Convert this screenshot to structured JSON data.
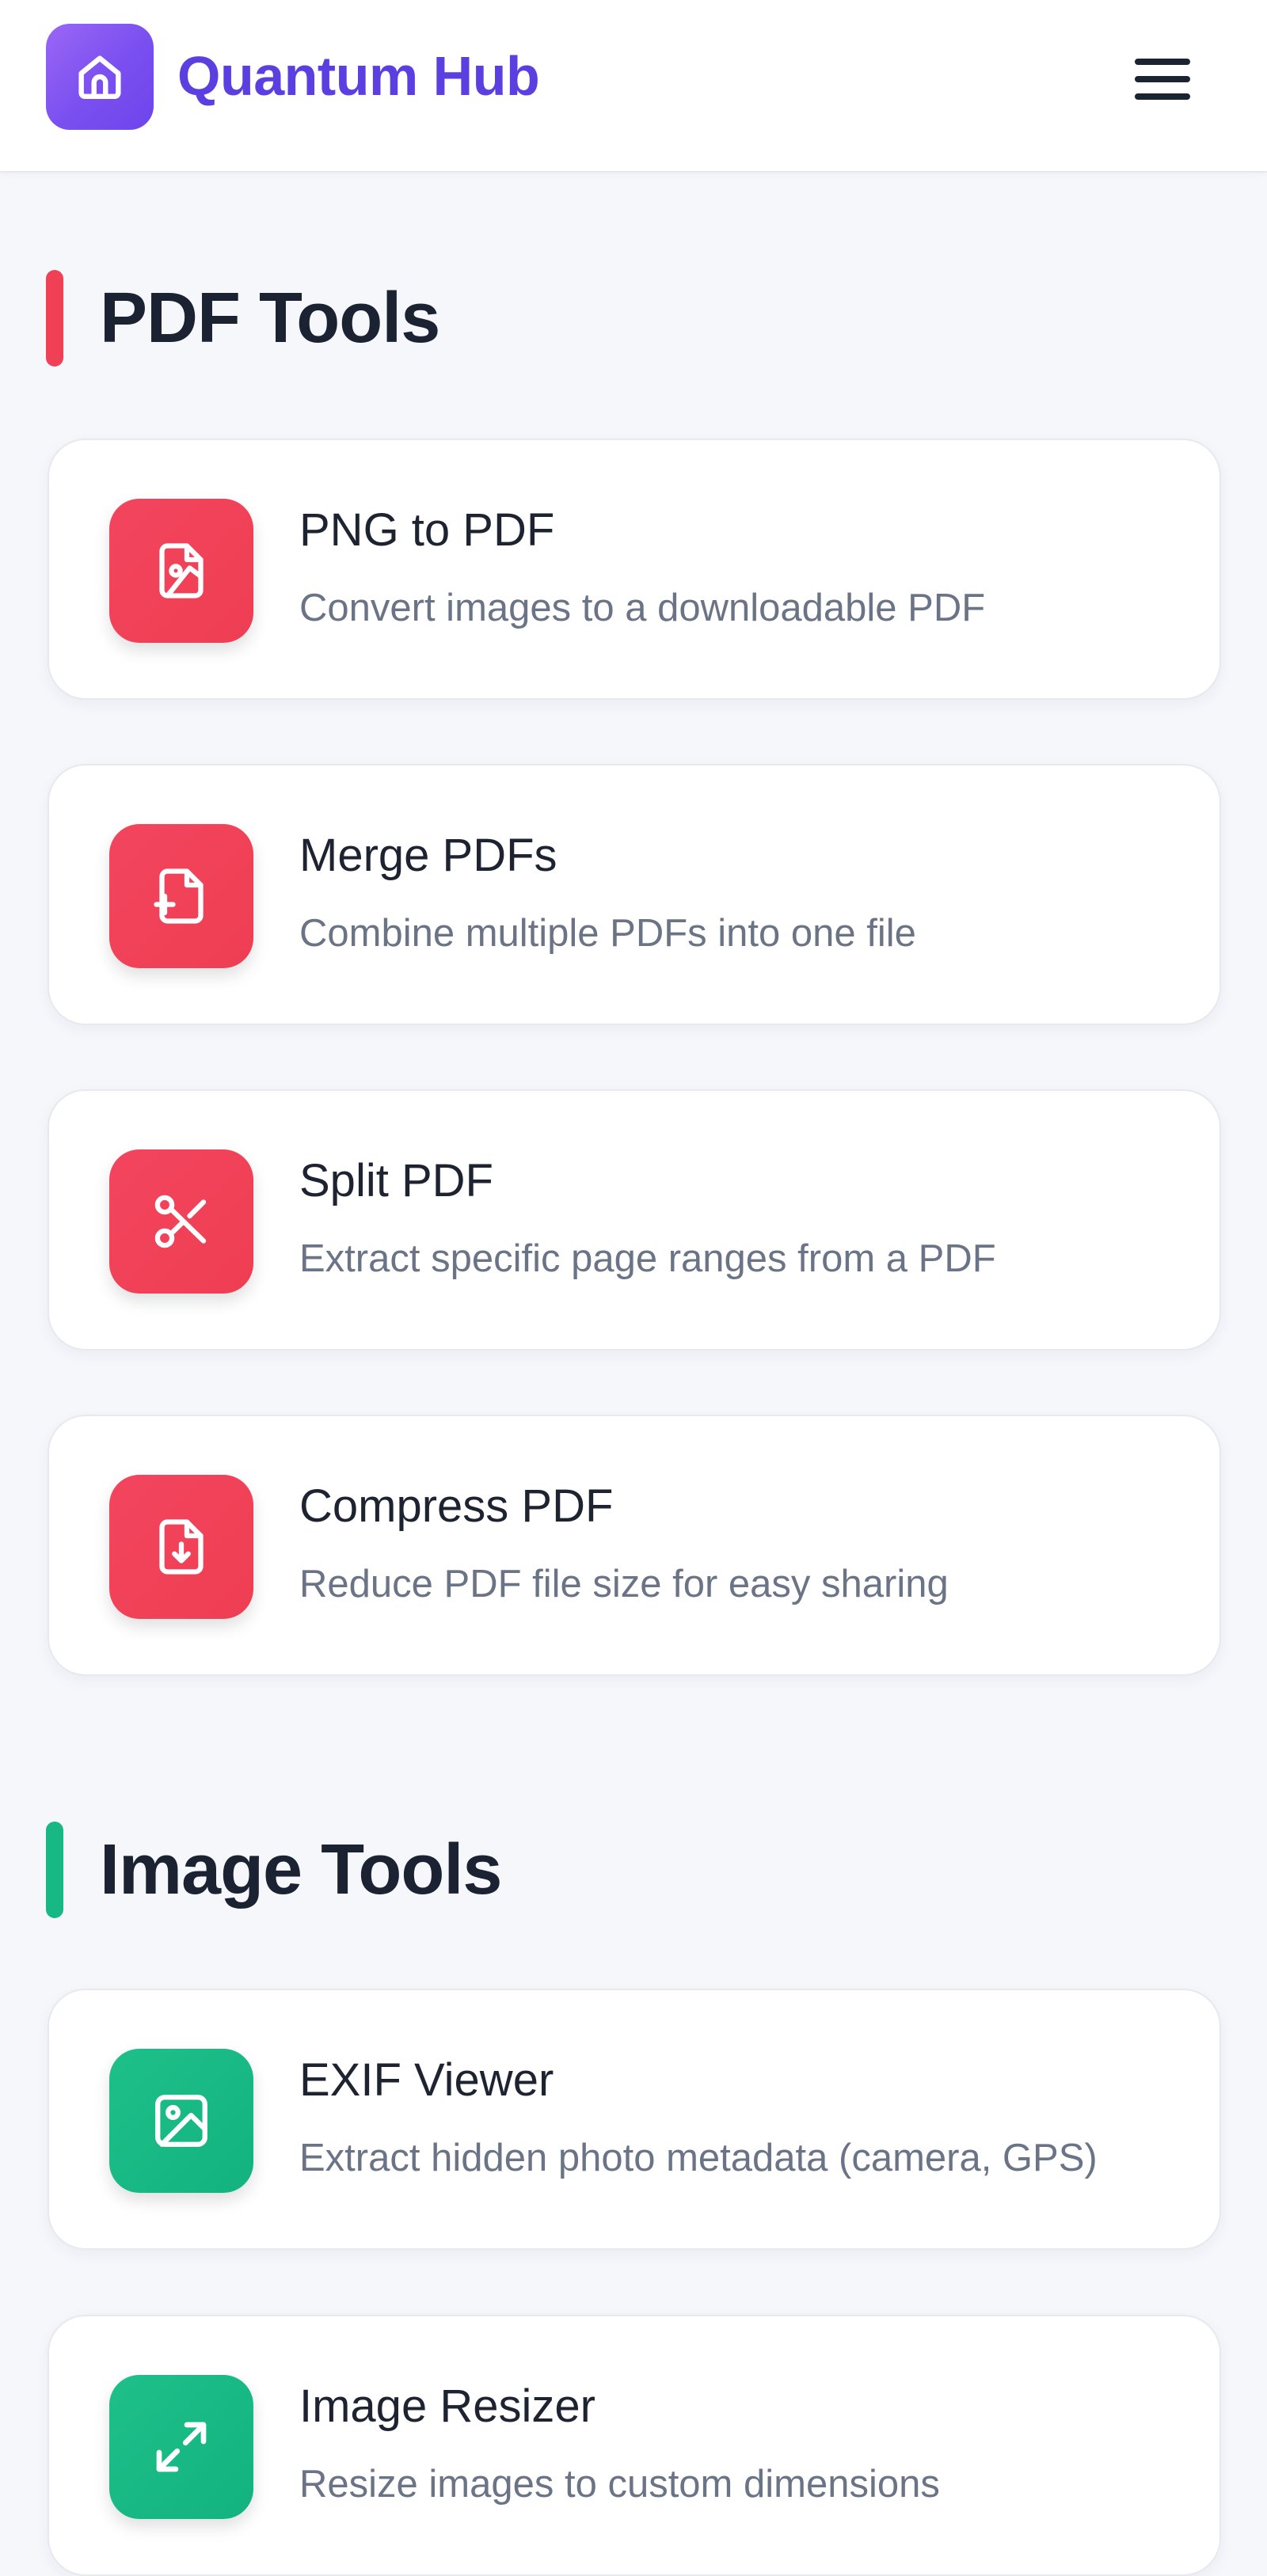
{
  "header": {
    "brand": "Quantum Hub",
    "logo_icon": "home-icon",
    "menu_icon": "hamburger-menu-icon"
  },
  "sections": [
    {
      "title": "PDF Tools",
      "accent": "#ef4056",
      "tools": [
        {
          "title": "PNG to PDF",
          "description": "Convert images to a downloadable PDF",
          "icon": "file-image-icon"
        },
        {
          "title": "Merge PDFs",
          "description": "Combine multiple PDFs into one file",
          "icon": "file-plus-icon"
        },
        {
          "title": "Split PDF",
          "description": "Extract specific page ranges from a PDF",
          "icon": "scissors-icon"
        },
        {
          "title": "Compress PDF",
          "description": "Reduce PDF file size for easy sharing",
          "icon": "file-download-icon"
        }
      ]
    },
    {
      "title": "Image Tools",
      "accent": "#17b884",
      "tools": [
        {
          "title": "EXIF Viewer",
          "description": "Extract hidden photo metadata (camera, GPS)",
          "icon": "image-icon"
        },
        {
          "title": "Image Resizer",
          "description": "Resize images to custom dimensions",
          "icon": "expand-arrows-icon"
        }
      ]
    }
  ]
}
